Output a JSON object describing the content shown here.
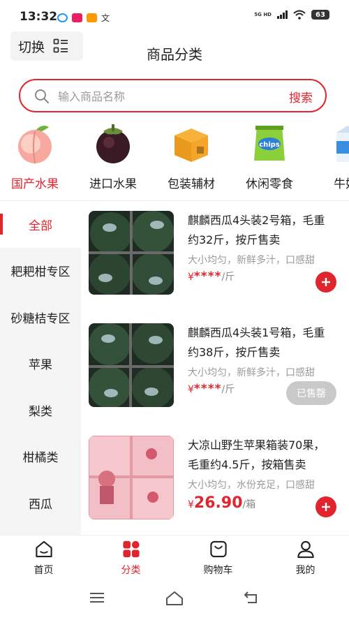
{
  "status_bar": {
    "time": "13:32",
    "network": "5G HD",
    "battery": "63"
  },
  "header": {
    "switch_label": "切换",
    "title": "商品分类"
  },
  "search": {
    "placeholder": "输入商品名称",
    "button_label": "搜索"
  },
  "categories": [
    {
      "label": "国产水果",
      "icon": "peach-icon",
      "active": true
    },
    {
      "label": "进口水果",
      "icon": "mangosteen-icon",
      "active": false
    },
    {
      "label": "包装辅材",
      "icon": "box-icon",
      "active": false
    },
    {
      "label": "休闲零食",
      "icon": "chips-icon",
      "active": false
    },
    {
      "label": "牛奶/",
      "icon": "milk-icon",
      "active": false
    }
  ],
  "sidebar": {
    "items": [
      {
        "label": "全部",
        "active": true
      },
      {
        "label": "耙耙柑专区",
        "active": false
      },
      {
        "label": "砂糖桔专区",
        "active": false
      },
      {
        "label": "苹果",
        "active": false
      },
      {
        "label": "梨类",
        "active": false
      },
      {
        "label": "柑橘类",
        "active": false
      },
      {
        "label": "西瓜",
        "active": false
      }
    ]
  },
  "products": [
    {
      "title": "麒麟西瓜4头装2号箱，毛重约32斤，按斤售卖",
      "desc": "大小均匀，新鲜多汁，口感甜",
      "currency": "¥",
      "price": "****",
      "unit": "/斤",
      "action": "add",
      "image": "watermelon-box-image"
    },
    {
      "title": "麒麟西瓜4头装1号箱，毛重约38斤，按斤售卖",
      "desc": "大小均匀，新鲜多汁，口感甜",
      "currency": "¥",
      "price": "****",
      "unit": "/斤",
      "action": "sold_out",
      "sold_out_label": "已售罄",
      "image": "watermelon-box-image"
    },
    {
      "title": "大凉山野生苹果箱装70果，毛重约4.5斤，按箱售卖",
      "desc": "大小均匀，水份充足，口感甜",
      "currency": "¥",
      "price": "26.90",
      "unit": "/箱",
      "action": "add",
      "image": "apple-box-image"
    }
  ],
  "bottom_nav": [
    {
      "label": "首页",
      "icon": "home-icon",
      "active": false
    },
    {
      "label": "分类",
      "icon": "category-icon",
      "active": true
    },
    {
      "label": "购物车",
      "icon": "cart-icon",
      "active": false
    },
    {
      "label": "我的",
      "icon": "profile-icon",
      "active": false
    }
  ],
  "colors": {
    "accent": "#e0252e",
    "sidebar_bg": "#f5f5f5",
    "muted_text": "#9a9a9a",
    "sold_out": "#c9c9c9"
  }
}
